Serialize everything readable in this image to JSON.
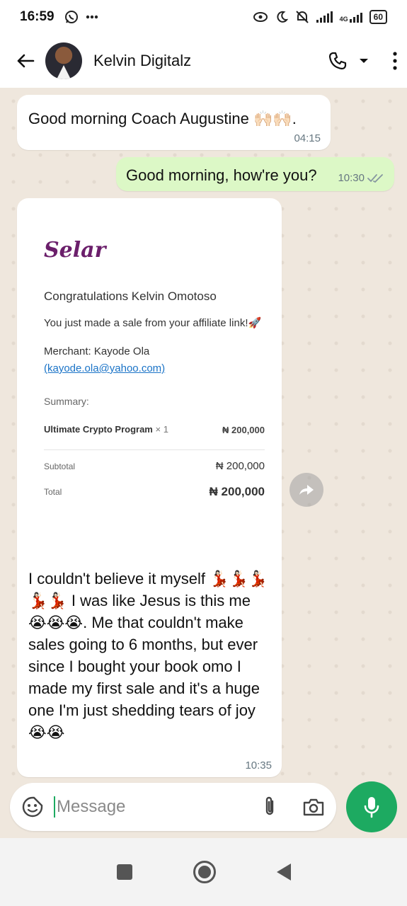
{
  "status_bar": {
    "time": "16:59",
    "network": "4G",
    "battery": "60",
    "icons": [
      "whatsapp-icon",
      "more-dots-icon",
      "hotspot-icon",
      "moon-icon",
      "mute-icon",
      "signal-icon",
      "battery-icon"
    ]
  },
  "header": {
    "contact_name": "Kelvin Digitalz",
    "icons": [
      "back-arrow-icon",
      "avatar",
      "phone-icon",
      "dropdown-icon",
      "kebab-menu-icon"
    ]
  },
  "messages": [
    {
      "direction": "incoming",
      "text": "Good morning Coach Augustine 🙌🏻🙌🏻.",
      "time": "04:15"
    },
    {
      "direction": "outgoing",
      "text": "Good morning, how're you?",
      "time": "10:30",
      "status": "read"
    },
    {
      "direction": "incoming",
      "time": "10:35",
      "receipt": {
        "brand": "Selar",
        "congrats": "Congratulations Kelvin Omotoso",
        "line1": "You just made a sale from your affiliate link!🚀",
        "merchant_prefix": "Merchant: Kayode Ola",
        "merchant_email": "(kayode.ola@yahoo.com)",
        "summary_label": "Summary:",
        "item_name": "Ultimate Crypto Program",
        "item_qty": "× 1",
        "item_price": "₦ 200,000",
        "subtotal_label": "Subtotal",
        "subtotal_value": "₦ 200,000",
        "total_label": "Total",
        "total_value": "₦ 200,000"
      },
      "text": "I couldn't believe it myself 💃🏻💃🏻💃🏻💃🏻💃🏻 I was like Jesus is this me 😭😭😭. Me that couldn't make sales going to 6 months, but ever since I bought your book omo I made my first sale and it's a huge one I'm just shedding tears of joy 😭😭"
    }
  ],
  "input": {
    "placeholder": "Message"
  },
  "colors": {
    "accent": "#1daa61",
    "outgoing_bubble": "#dcf8c6",
    "chat_bg": "#efe7dd",
    "selar_brand": "#6b1f6b"
  }
}
